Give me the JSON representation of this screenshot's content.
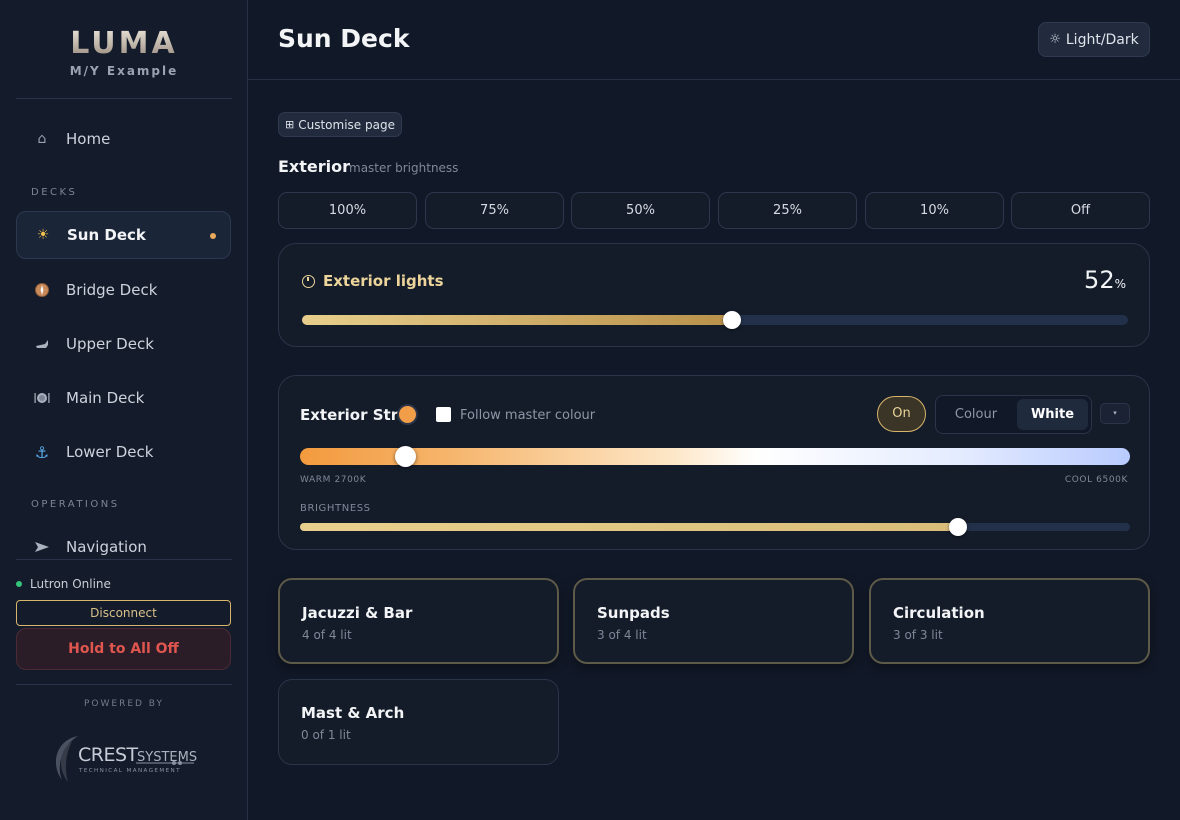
{
  "brand": {
    "name": "LUMA",
    "vessel": "M/Y Example"
  },
  "sidebar": {
    "home": {
      "label": "Home",
      "icon": "home-icon"
    },
    "decks_heading": "DECKS",
    "decks": [
      {
        "label": "Sun Deck",
        "icon": "sun-icon",
        "active": true
      },
      {
        "label": "Bridge Deck",
        "icon": "compass-icon"
      },
      {
        "label": "Upper Deck",
        "icon": "lounge-chair-icon"
      },
      {
        "label": "Main Deck",
        "icon": "dining-icon"
      },
      {
        "label": "Lower Deck",
        "icon": "anchor-icon"
      }
    ],
    "operations_heading": "OPERATIONS",
    "operations": [
      {
        "label": "Navigation",
        "icon": "navigation-arrow-icon"
      }
    ],
    "status": "Lutron Online",
    "disconnect_label": "Disconnect",
    "all_off_label": "Hold to All Off",
    "powered_by": "POWERED BY",
    "partner": {
      "name": "CREST",
      "name2": "SYSTEMS",
      "tagline": "TECHNICAL MANAGEMENT"
    }
  },
  "header": {
    "title": "Sun Deck",
    "theme_toggle": "Light/Dark"
  },
  "customise_label": "Customise page",
  "exterior": {
    "title": "Exterior",
    "subtitle": "master brightness",
    "presets": [
      "100%",
      "75%",
      "50%",
      "25%",
      "10%",
      "Off"
    ]
  },
  "exterior_lights": {
    "title": "Exterior lights",
    "value": "52",
    "unit": "%",
    "level": 0.52
  },
  "strip": {
    "title": "Exterior Strip",
    "swatch_color": "#f29d48",
    "follow_label": "Follow master colour",
    "follow_checked": false,
    "power": "On",
    "mode_options": [
      "Colour",
      "White"
    ],
    "mode_selected": "White",
    "more": "▾",
    "warm_label": "WARM 2700K",
    "cool_label": "COOL 6500K",
    "cct_level": 0.127,
    "brightness_label": "BRIGHTNESS",
    "brightness_level": 0.793
  },
  "rooms": [
    {
      "name": "Jacuzzi & Bar",
      "status": "4 of 4 lit"
    },
    {
      "name": "Sunpads",
      "status": "3 of 4 lit"
    },
    {
      "name": "Circulation",
      "status": "3 of 3 lit"
    },
    {
      "name": "Mast & Arch",
      "status": "0 of 1 lit"
    }
  ],
  "colors": {
    "accent": "#d7b56a",
    "danger": "#e0564f",
    "online": "#34c47a",
    "background": "#111827"
  }
}
